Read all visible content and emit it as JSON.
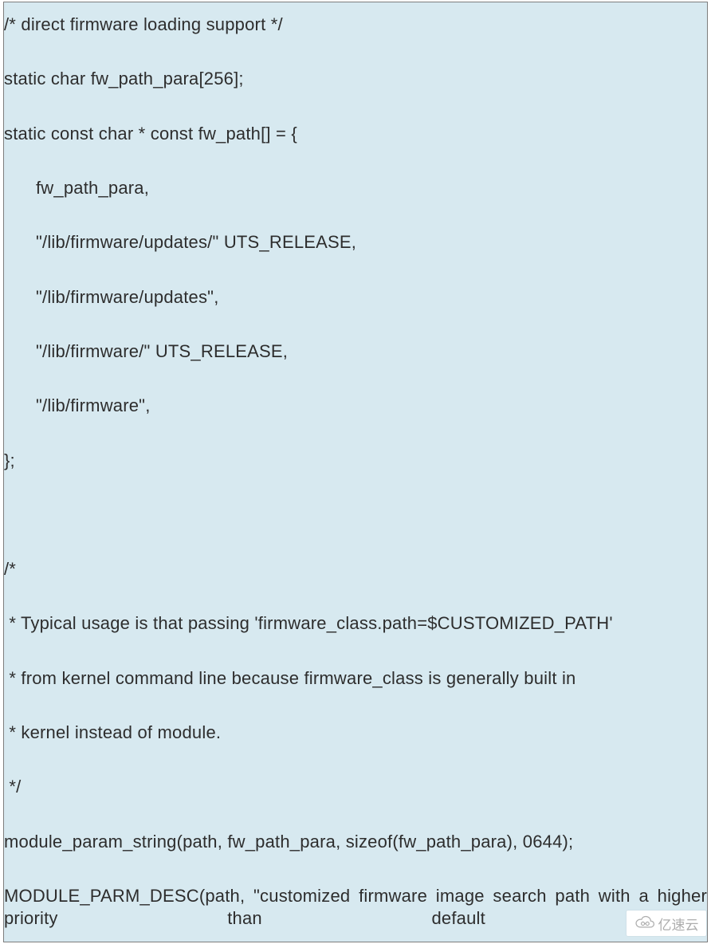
{
  "code": {
    "l1": "/* direct firmware loading support */",
    "l2": "static char fw_path_para[256];",
    "l3": "static const char * const fw_path[] = {",
    "l4": "fw_path_para,",
    "l5": "\"/lib/firmware/updates/\" UTS_RELEASE,",
    "l6": "\"/lib/firmware/updates\",",
    "l7": "\"/lib/firmware/\" UTS_RELEASE,",
    "l8": "\"/lib/firmware\",",
    "l9": "};",
    "l10": "/*",
    "l11": " * Typical usage is that passing 'firmware_class.path=$CUSTOMIZED_PATH'",
    "l12": " * from kernel command line because firmware_class is generally built in",
    "l13": " * kernel instead of module.",
    "l14": " */",
    "l15": "module_param_string(path, fw_path_para, sizeof(fw_path_para), 0644);",
    "l16": "MODULE_PARM_DESC(path, \"customized firmware image search path with a higher priority than default path\");"
  },
  "watermark": {
    "text": "亿速云"
  }
}
